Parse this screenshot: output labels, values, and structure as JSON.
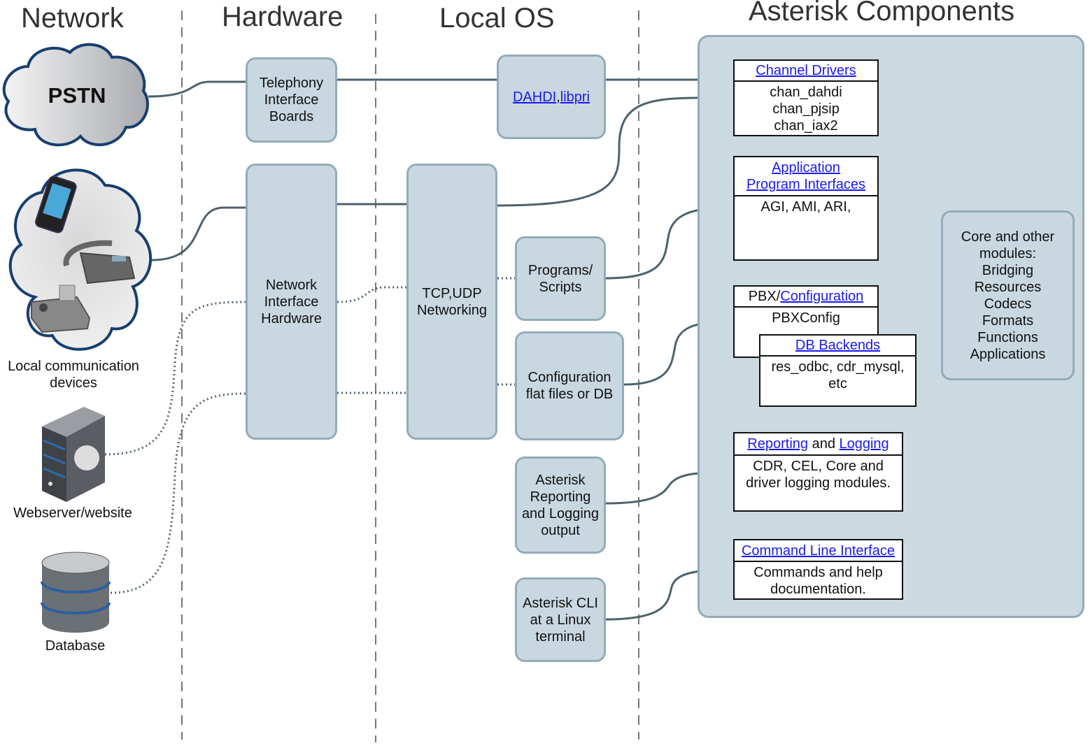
{
  "headers": {
    "network": "Network",
    "hardware": "Hardware",
    "local_os": "Local OS",
    "components": "Asterisk Components"
  },
  "network": {
    "pstn": "PSTN",
    "local_devices": "Local communication\ndevices",
    "webserver": "Webserver/website",
    "database": "Database"
  },
  "hardware": {
    "telephony": "Telephony\nInterface\nBoards",
    "nic": "Network\nInterface\nHardware"
  },
  "local_os": {
    "dahdi_link": "DAHDI",
    "sep": ",",
    "libpri_link": "libpri",
    "tcpudp": "TCP,UDP\nNetworking",
    "programs": "Programs/\nScripts",
    "config": "Configuration\nflat files or DB",
    "reporting": "Asterisk\nReporting\nand Logging\noutput",
    "cli": "Asterisk CLI\nat a Linux\nterminal"
  },
  "components": {
    "channel_drivers": {
      "title": "Channel Drivers",
      "body": "chan_dahdi\nchan_pjsip\nchan_iax2"
    },
    "api": {
      "title1": "Application",
      "title2": "Program Interfaces",
      "body": "AGI, AMI, ARI,"
    },
    "pbx": {
      "prefix": "PBX/",
      "title": "Configuration",
      "body": "PBXConfig"
    },
    "db": {
      "title": "DB Backends",
      "body": "res_odbc, cdr_mysql,\netc"
    },
    "reporting": {
      "title1": "Reporting",
      "and": " and ",
      "title2": "Logging",
      "body": "CDR, CEL, Core and\ndriver logging modules."
    },
    "cli": {
      "title": "Command Line Interface",
      "body": "Commands and help\ndocumentation."
    },
    "core": "Core and other\nmodules:\nBridging\nResources\nCodecs\nFormats\nFunctions\nApplications"
  },
  "colors": {
    "box_fill": "#c9d8e0",
    "box_border": "#93abb9",
    "link": "#1a1aee",
    "connector": "#4d626d"
  }
}
